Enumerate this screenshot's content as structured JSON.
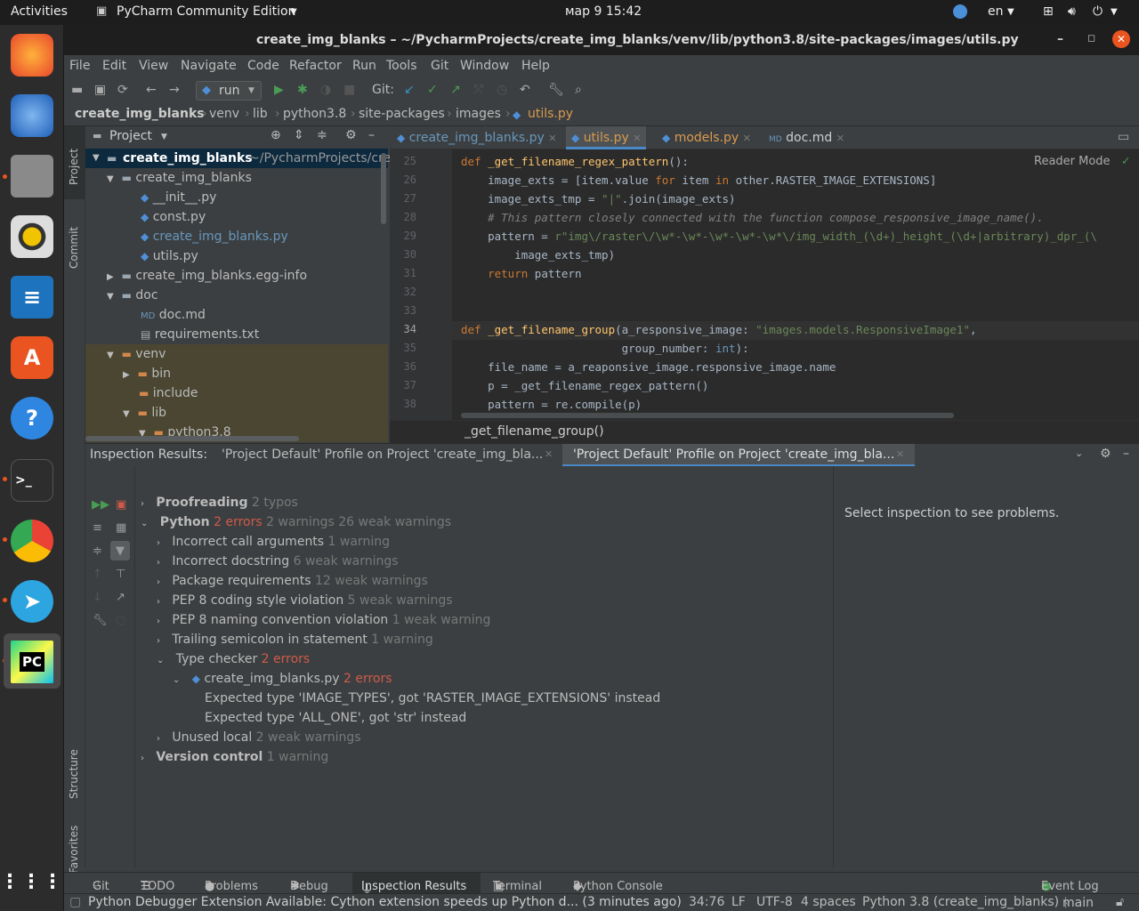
{
  "topbar": {
    "activities": "Activities",
    "app": "PyCharm Community Edition",
    "datetime": "мар 9  15:42",
    "lang": "en"
  },
  "window": {
    "title": "create_img_blanks – ~/PycharmProjects/create_img_blanks/venv/lib/python3.8/site-packages/images/utils.py"
  },
  "menu": [
    "File",
    "Edit",
    "View",
    "Navigate",
    "Code",
    "Refactor",
    "Run",
    "Tools",
    "Git",
    "Window",
    "Help"
  ],
  "toolbar": {
    "run_config": "run",
    "git_label": "Git:"
  },
  "breadcrumbs": [
    "create_img_blanks",
    "venv",
    "lib",
    "python3.8",
    "site-packages",
    "images",
    "utils.py"
  ],
  "sidebar_left": {
    "project": "Project",
    "commit": "Commit",
    "structure": "Structure",
    "favorites": "Favorites"
  },
  "project": {
    "header": "Project",
    "root": "create_img_blanks",
    "root_path": "~/PycharmProjects/cre",
    "items": [
      "create_img_blanks",
      "__init__.py",
      "const.py",
      "create_img_blanks.py",
      "utils.py",
      "create_img_blanks.egg-info",
      "doc",
      "doc.md",
      "requirements.txt",
      "venv",
      "bin",
      "include",
      "lib",
      "python3.8"
    ]
  },
  "tabs": [
    "create_img_blanks.py",
    "utils.py",
    "models.py",
    "doc.md"
  ],
  "editor": {
    "reader_mode": "Reader Mode",
    "line_numbers": [
      "25",
      "26",
      "27",
      "28",
      "29",
      "30",
      "31",
      "32",
      "33",
      "34",
      "35",
      "36",
      "37",
      "38"
    ],
    "function_breadcrumb": "_get_filename_group()"
  },
  "inspection": {
    "label": "Inspection Results:",
    "tab1": "'Project Default' Profile on Project 'create_img_bla...",
    "tab2": "'Project Default' Profile on Project 'create_img_bla...",
    "right_msg": "Select inspection to see problems.",
    "rows": [
      {
        "label": "Proofreading",
        "count": "2 typos"
      },
      {
        "label": "Python",
        "err": "2 errors",
        "count": "2 warnings 26 weak warnings"
      },
      {
        "label": "Incorrect call arguments",
        "count": "1 warning"
      },
      {
        "label": "Incorrect docstring",
        "count": "6 weak warnings"
      },
      {
        "label": "Package requirements",
        "count": "12 weak warnings"
      },
      {
        "label": "PEP 8 coding style violation",
        "count": "5 weak warnings"
      },
      {
        "label": "PEP 8 naming convention violation",
        "count": "1 weak warning"
      },
      {
        "label": "Trailing semicolon in statement",
        "count": "1 warning"
      },
      {
        "label": "Type checker",
        "err": "2 errors"
      },
      {
        "label": "create_img_blanks.py",
        "err": "2 errors"
      },
      {
        "label": "Expected type 'IMAGE_TYPES', got 'RASTER_IMAGE_EXTENSIONS' instead"
      },
      {
        "label": "Expected type 'ALL_ONE', got 'str' instead"
      },
      {
        "label": "Unused local",
        "count": "2 weak warnings"
      },
      {
        "label": "Version control",
        "count": "1 warning"
      }
    ]
  },
  "bottom_tabs": [
    "Git",
    "TODO",
    "Problems",
    "Debug",
    "Inspection Results",
    "Terminal",
    "Python Console",
    "Event Log"
  ],
  "status": {
    "message": "Python Debugger Extension Available: Cython extension speeds up Python d... (3 minutes ago)",
    "pos": "34:76",
    "le": "LF",
    "enc": "UTF-8",
    "indent": "4 spaces",
    "interp": "Python 3.8 (create_img_blanks)",
    "branch": "main"
  }
}
